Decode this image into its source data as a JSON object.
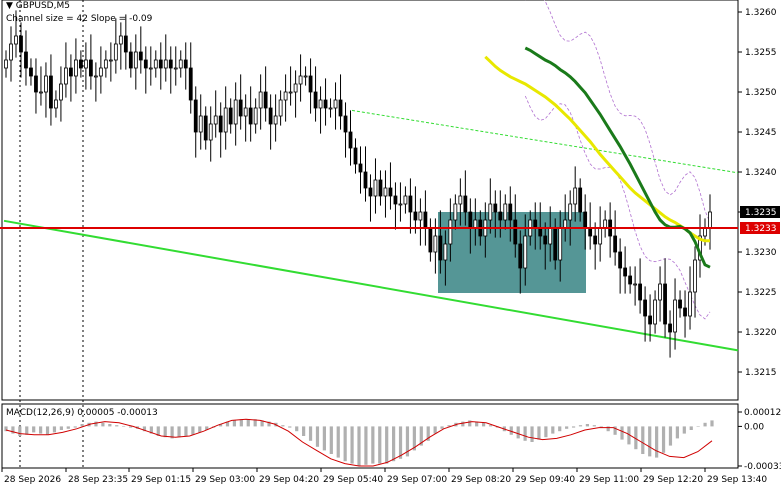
{
  "header": {
    "symbol": "GBPUSD,M5",
    "channel_label": "Channel size = 42 Slope = -0.09"
  },
  "macd": {
    "label": "MACD(12,26,9) 0.00005 -0.00013",
    "scale": [
      "0.00012",
      "0.00",
      "-0.00033"
    ]
  },
  "colors": {
    "candle": "#000000",
    "ma_fast": "#1a7a1a",
    "ma_slow": "#e8e800",
    "envelope": "#b070d0",
    "support_line": "#32dc32",
    "resistance_line": "#32dc32",
    "horizontal_level": "#dd0000",
    "zone": "#2f7f7f",
    "macd_hist": "#b0b0b0",
    "macd_signal": "#d00000",
    "price_tag": "#000000"
  },
  "chart_data": {
    "type": "line",
    "title": "GBPUSD,M5",
    "y_ticks": [
      "1.3260",
      "1.3255",
      "1.3250",
      "1.3245",
      "1.3240",
      "1.3235",
      "1.3230",
      "1.3225",
      "1.3220",
      "1.3215"
    ],
    "y_tick_values": [
      1.326,
      1.3255,
      1.325,
      1.3245,
      1.324,
      1.3235,
      1.323,
      1.3225,
      1.322,
      1.3215
    ],
    "ylim": [
      1.32115,
      1.32615
    ],
    "x_ticks": [
      "28 Sep 2026",
      "28 Sep 23:35",
      "29 Sep 01:15",
      "29 Sep 03:00",
      "29 Sep 04:20",
      "29 Sep 05:40",
      "29 Sep 07:00",
      "29 Sep 08:20",
      "29 Sep 09:40",
      "29 Sep 11:00",
      "29 Sep 12:20",
      "29 Sep 13:40"
    ],
    "current_price": "1.3235",
    "level_price": "1.3233",
    "level_value": 1.3233,
    "close": [
      1.3254,
      1.3256,
      1.3257,
      1.3255,
      1.3253,
      1.3252,
      1.325,
      1.325,
      1.3252,
      1.3248,
      1.3249,
      1.3251,
      1.3253,
      1.3252,
      1.3254,
      1.3253,
      1.3254,
      1.3252,
      1.3252,
      1.3253,
      1.3254,
      1.3254,
      1.3256,
      1.3257,
      1.3255,
      1.3253,
      1.3255,
      1.3254,
      1.3253,
      1.3253,
      1.3254,
      1.3253,
      1.3254,
      1.3253,
      1.3253,
      1.3254,
      1.3253,
      1.3249,
      1.3245,
      1.3247,
      1.3244,
      1.3246,
      1.3247,
      1.3245,
      1.3248,
      1.3246,
      1.3249,
      1.3247,
      1.3248,
      1.3246,
      1.3248,
      1.325,
      1.3248,
      1.3246,
      1.3247,
      1.3249,
      1.325,
      1.325,
      1.3251,
      1.3252,
      1.3252,
      1.325,
      1.3248,
      1.3249,
      1.3248,
      1.3248,
      1.3249,
      1.3247,
      1.3245,
      1.3243,
      1.3241,
      1.324,
      1.3238,
      1.3237,
      1.3239,
      1.3237,
      1.3238,
      1.3237,
      1.3236,
      1.3236,
      1.3237,
      1.3235,
      1.3234,
      1.3235,
      1.3233,
      1.323,
      1.3232,
      1.3229,
      1.3231,
      1.3234,
      1.3236,
      1.3237,
      1.3235,
      1.3233,
      1.3234,
      1.3232,
      1.3234,
      1.3236,
      1.3235,
      1.3234,
      1.3236,
      1.3234,
      1.3231,
      1.3228,
      1.3232,
      1.3234,
      1.3233,
      1.3232,
      1.3231,
      1.3233,
      1.3229,
      1.3233,
      1.3234,
      1.3236,
      1.3238,
      1.3235,
      1.3233,
      1.3232,
      1.3231,
      1.3233,
      1.3234,
      1.3232,
      1.323,
      1.3228,
      1.3227,
      1.3226,
      1.3226,
      1.3224,
      1.3222,
      1.3221,
      1.3224,
      1.3226,
      1.3221,
      1.322,
      1.3224,
      1.3223,
      1.3222,
      1.3225,
      1.3229,
      1.3232,
      1.3233,
      1.3235
    ],
    "ma_fast": [
      1.32555,
      1.32552,
      1.32548,
      1.32544,
      1.3254,
      1.32537,
      1.32533,
      1.32528,
      1.32524,
      1.32519,
      1.32513,
      1.32506,
      1.32499,
      1.3249,
      1.32481,
      1.32472,
      1.32462,
      1.32452,
      1.32442,
      1.32432,
      1.32421,
      1.3241,
      1.32398,
      1.32386,
      1.32374,
      1.32362,
      1.3235,
      1.3234,
      1.32334,
      1.32331,
      1.32331,
      1.32332,
      1.32329,
      1.32324,
      1.32313,
      1.32298,
      1.32284,
      1.32281
    ],
    "ma_slow": [
      1.32544,
      1.32538,
      1.32532,
      1.32527,
      1.32523,
      1.32519,
      1.32516,
      1.32513,
      1.3251,
      1.32506,
      1.32502,
      1.32498,
      1.32494,
      1.32489,
      1.32484,
      1.32478,
      1.32472,
      1.32466,
      1.32459,
      1.32452,
      1.32445,
      1.32438,
      1.3243,
      1.32422,
      1.32415,
      1.32408,
      1.32401,
      1.32394,
      1.32387,
      1.3238,
      1.32374,
      1.32369,
      1.32364,
      1.32359,
      1.32354,
      1.32349,
      1.32344,
      1.3234,
      1.32337,
      1.32333,
      1.32329,
      1.32324,
      1.3232,
      1.32316,
      1.32314,
      1.32314
    ],
    "macd_hist": [
      -4e-05,
      -6e-05,
      -8e-05,
      -7e-05,
      -5e-05,
      -6e-05,
      -7e-05,
      -5e-05,
      -3e-05,
      -2e-05,
      -1e-05,
      2e-05,
      3e-05,
      4e-05,
      3e-05,
      2e-05,
      1e-05,
      0.0,
      -1e-05,
      -2e-05,
      -4e-05,
      -6e-05,
      -8e-05,
      -9e-05,
      -0.0001,
      -9e-05,
      -8e-05,
      -7e-05,
      -5e-05,
      -3e-05,
      -1e-05,
      2e-05,
      4e-05,
      5e-05,
      6e-05,
      6e-05,
      6e-05,
      5e-05,
      4e-05,
      3e-05,
      1e-05,
      -1e-05,
      -4e-05,
      -8e-05,
      -0.00012,
      -0.00017,
      -0.0002,
      -0.00023,
      -0.00026,
      -0.00029,
      -0.00031,
      -0.00033,
      -0.00032,
      -0.00031,
      -0.00031,
      -0.00031,
      -0.00029,
      -0.00027,
      -0.00025,
      -0.0002,
      -0.00016,
      -0.00012,
      -6e-05,
      -2e-05,
      1e-05,
      3e-05,
      4e-05,
      5e-05,
      4e-05,
      3e-05,
      1e-05,
      -1e-05,
      -4e-05,
      -7e-05,
      -0.0001,
      -0.00012,
      -0.00013,
      -0.00011,
      -9e-05,
      -6e-05,
      -4e-05,
      -2e-05,
      -1e-05,
      1e-05,
      2e-05,
      1e-05,
      -1e-05,
      -4e-05,
      -7e-05,
      -0.00011,
      -0.00015,
      -0.00019,
      -0.00023,
      -0.00025,
      -0.00026,
      -0.00022,
      -0.00016,
      -0.0001,
      -6e-05,
      -3e-05,
      0.0,
      3e-05,
      5e-05
    ],
    "macd_signal": [
      -3e-05,
      -6e-05,
      -7e-05,
      -7e-05,
      -5e-05,
      -2e-05,
      2e-05,
      4e-05,
      3e-05,
      0.0,
      -4e-05,
      -8e-05,
      -9e-05,
      -8e-05,
      -4e-05,
      1e-05,
      5e-05,
      6e-05,
      5e-05,
      2e-05,
      -4e-05,
      -0.00013,
      -0.0002,
      -0.00027,
      -0.00031,
      -0.00033,
      -0.00033,
      -0.0003,
      -0.00024,
      -0.00017,
      -9e-05,
      -2e-05,
      2e-05,
      4e-05,
      3e-05,
      -1e-05,
      -5e-05,
      -9e-05,
      -0.00011,
      -0.0001,
      -7e-05,
      -3e-05,
      -1e-05,
      -1e-05,
      -6e-05,
      -0.00013,
      -0.0002,
      -0.00025,
      -0.00026,
      -0.00021,
      -0.00012
    ]
  }
}
